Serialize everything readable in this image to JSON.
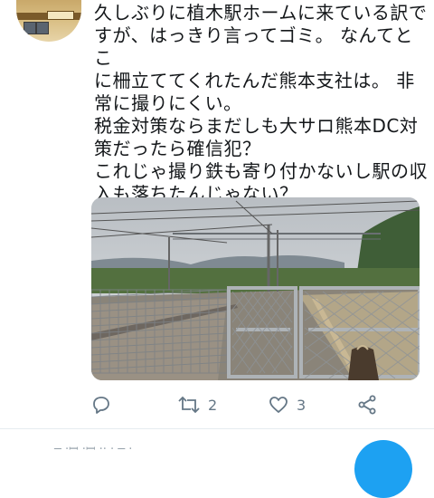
{
  "tweet": {
    "lines": [
      "久しぶりに植木駅ホームに来ている訳で",
      "すが、はっきり言ってゴミ。 なんてとこ",
      "に柵立ててくれたんだ熊本支社は。 非",
      "常に撮りにくい。",
      "税金対策ならまだしも大サロ熊本DC対",
      "策だったら確信犯？",
      "これじゃ撮り鉄も寄り付かないし駅の収",
      "入も落ちたんじゃない？"
    ],
    "avatar_plate": "203"
  },
  "actions": {
    "reply_icon": "reply-icon",
    "retweet_icon": "retweet-icon",
    "retweet_count": "2",
    "like_icon": "heart-icon",
    "like_count": "3",
    "share_icon": "share-icon"
  },
  "footer": {
    "partial_text": "─ ·ꟷ  ·ꟷ ··  ·  ─  ·"
  },
  "colors": {
    "icon_gray": "#657786",
    "accent": "#1da1f2"
  }
}
